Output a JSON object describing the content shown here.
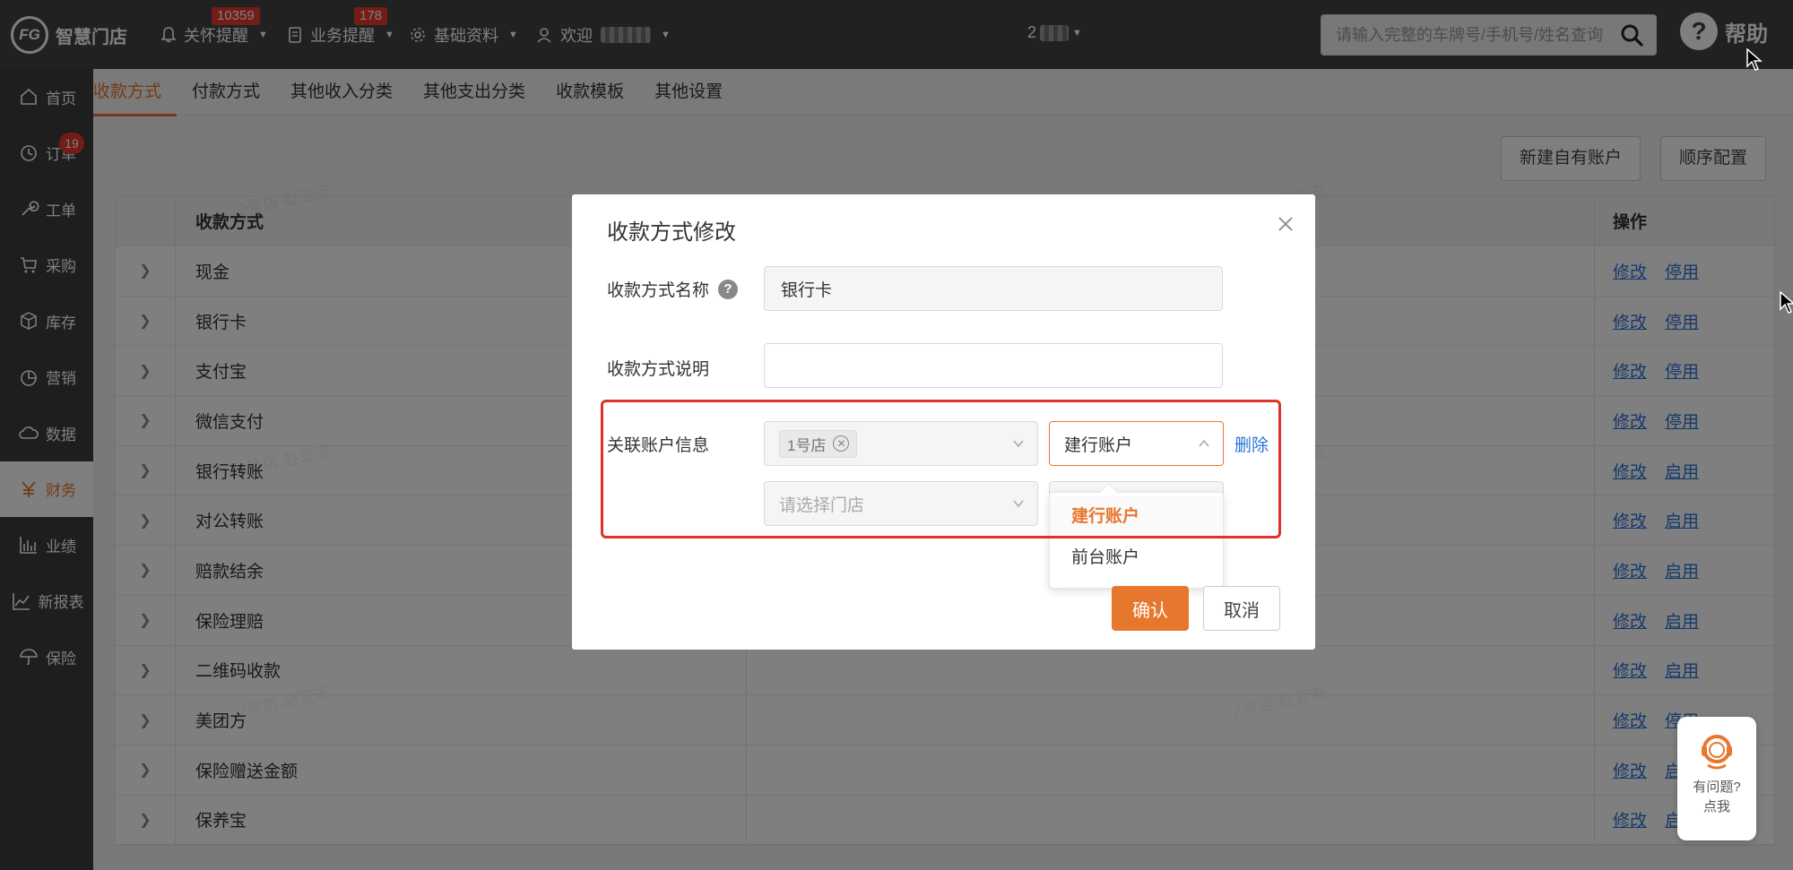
{
  "app": {
    "logo_text": "智慧门店",
    "logo_mark": "FG"
  },
  "topnav": {
    "care": {
      "label": "关怀提醒",
      "badge": "10359"
    },
    "business": {
      "label": "业务提醒",
      "badge": "178"
    },
    "basic": {
      "label": "基础资料"
    },
    "welcome": {
      "label": "欢迎"
    },
    "store": {
      "label": "2"
    },
    "search_placeholder": "请输入完整的车牌号/手机号/姓名查询",
    "help_label": "帮助"
  },
  "sidebar": {
    "items": [
      {
        "label": "首页",
        "icon": "home-icon"
      },
      {
        "label": "订单",
        "icon": "clock-icon",
        "badge": "19"
      },
      {
        "label": "工单",
        "icon": "wrench-icon"
      },
      {
        "label": "采购",
        "icon": "cart-icon"
      },
      {
        "label": "库存",
        "icon": "box-icon"
      },
      {
        "label": "营销",
        "icon": "pie-icon"
      },
      {
        "label": "数据",
        "icon": "cloud-icon"
      },
      {
        "label": "财务",
        "icon": "yen-icon",
        "active": true
      },
      {
        "label": "业绩",
        "icon": "bar-chart-icon"
      },
      {
        "label": "新报表",
        "icon": "line-chart-icon"
      },
      {
        "label": "保险",
        "icon": "umbrella-icon"
      }
    ]
  },
  "tabs": [
    "收款方式",
    "付款方式",
    "其他收入分类",
    "其他支出分类",
    "收款模板",
    "其他设置"
  ],
  "toolbar": {
    "new_account": "新建自有账户",
    "order_config": "顺序配置"
  },
  "table": {
    "headers": {
      "name": "收款方式",
      "op": "操作"
    },
    "rows": [
      {
        "name": "现金",
        "edit": "修改",
        "toggle": "停用"
      },
      {
        "name": "银行卡",
        "edit": "修改",
        "toggle": "停用"
      },
      {
        "name": "支付宝",
        "edit": "修改",
        "toggle": "停用"
      },
      {
        "name": "微信支付",
        "edit": "修改",
        "toggle": "停用"
      },
      {
        "name": "银行转账",
        "edit": "修改",
        "toggle": "启用"
      },
      {
        "name": "对公转账",
        "edit": "修改",
        "toggle": "启用"
      },
      {
        "name": "赔款结余",
        "edit": "修改",
        "toggle": "启用"
      },
      {
        "name": "保险理赔",
        "edit": "修改",
        "toggle": "启用"
      },
      {
        "name": "二维码收款",
        "edit": "修改",
        "toggle": "启用"
      },
      {
        "name": "美团方",
        "edit": "修改",
        "toggle": "停用"
      },
      {
        "name": "保险赠送金额",
        "edit": "修改",
        "toggle": "启用"
      },
      {
        "name": "保养宝",
        "edit": "修改",
        "toggle": "启用"
      }
    ]
  },
  "watermark": "2号店-赵亚宏",
  "modal": {
    "title": "收款方式修改",
    "name_label": "收款方式名称",
    "name_value": "银行卡",
    "desc_label": "收款方式说明",
    "desc_value": "",
    "account_label": "关联账户信息",
    "store_tag": "1号店",
    "account_selected": "建行账户",
    "delete_label": "删除",
    "store_placeholder": "请选择门店",
    "dropdown_options": [
      "建行账户",
      "前台账户"
    ],
    "confirm": "确认",
    "cancel": "取消"
  },
  "float_help": {
    "line1": "有问题?",
    "line2": "点我"
  },
  "colors": {
    "accent": "#e8772e",
    "topbar": "#434343",
    "sidebar": "#3c3c3c",
    "link": "#2a73d6",
    "badge": "#e8382f",
    "highlight": "#e0322a"
  }
}
